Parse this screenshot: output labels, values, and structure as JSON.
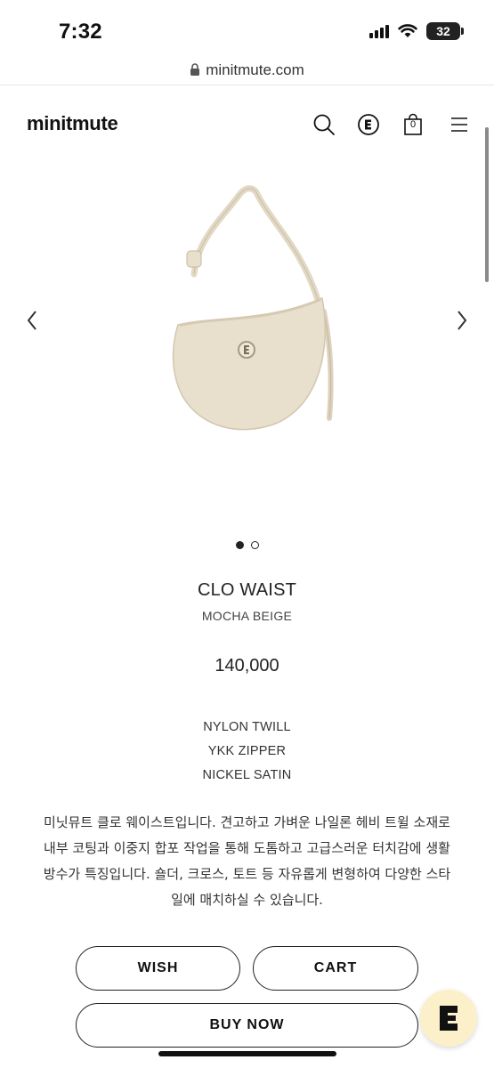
{
  "status_bar": {
    "time": "7:32",
    "battery": "32"
  },
  "browser": {
    "url": "minitmute.com"
  },
  "header": {
    "logo": "minitmute",
    "cart_count": "0"
  },
  "gallery": {
    "slide_count": 2,
    "active_index": 0
  },
  "product": {
    "name": "CLO WAIST",
    "color": "MOCHA BEIGE",
    "price": "140,000",
    "specs": [
      "NYLON TWILL",
      "YKK ZIPPER",
      "NICKEL SATIN"
    ],
    "description": "미닛뮤트 클로 웨이스트입니다. 견고하고 가벼운 나일론 헤비 트윌 소재로 내부 코팅과 이중지 합포 작업을 통해 도톰하고 고급스러운 터치감에 생활 방수가 특징입니다. 숄더, 크로스, 토트 등 자유롭게 변형하여 다양한 스타일에 매치하실 수 있습니다."
  },
  "actions": {
    "wish": "WISH",
    "cart": "CART",
    "buy_now": "BUY NOW"
  },
  "icons": {
    "search": "search-icon",
    "e_logo": "e-logo-icon",
    "cart": "shopping-bag-icon",
    "menu": "hamburger-menu-icon",
    "prev": "chevron-left-icon",
    "next": "chevron-right-icon",
    "lock": "lock-icon",
    "chat": "e-chat-icon"
  },
  "colors": {
    "bag": "#e6dcc8",
    "fab_bg": "#fbf0c9",
    "text": "#222222"
  }
}
